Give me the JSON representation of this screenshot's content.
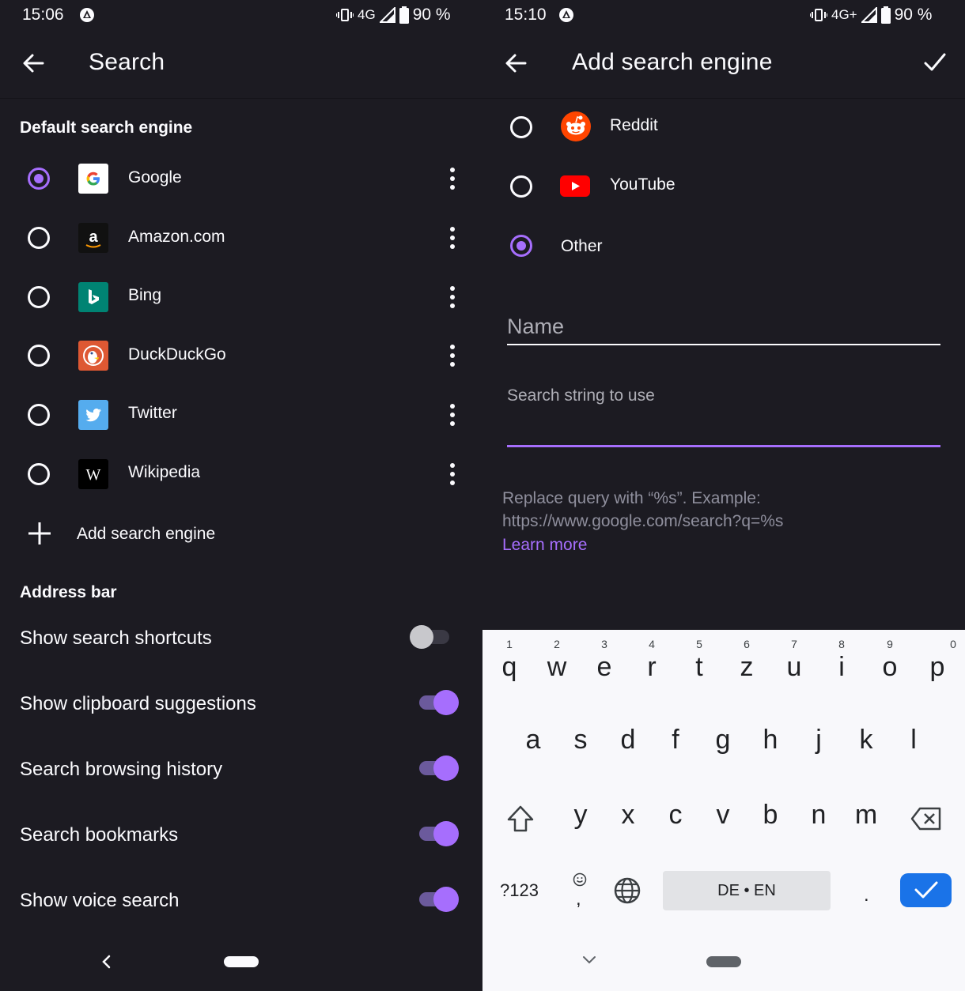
{
  "left": {
    "status": {
      "time": "15:06",
      "network": "4G",
      "battery": "90 %"
    },
    "toolbar": {
      "title": "Search"
    },
    "default_section": {
      "title": "Default search engine"
    },
    "engines": [
      {
        "label": "Google",
        "selected": true,
        "icon": "google-icon"
      },
      {
        "label": "Amazon.com",
        "selected": false,
        "icon": "amazon-icon"
      },
      {
        "label": "Bing",
        "selected": false,
        "icon": "bing-icon"
      },
      {
        "label": "DuckDuckGo",
        "selected": false,
        "icon": "duckduckgo-icon"
      },
      {
        "label": "Twitter",
        "selected": false,
        "icon": "twitter-icon"
      },
      {
        "label": "Wikipedia",
        "selected": false,
        "icon": "wikipedia-icon"
      }
    ],
    "add_engine": {
      "label": "Add search engine"
    },
    "address_section": {
      "title": "Address bar"
    },
    "settings": [
      {
        "label": "Show search shortcuts",
        "enabled": false
      },
      {
        "label": "Show clipboard suggestions",
        "enabled": true
      },
      {
        "label": "Search browsing history",
        "enabled": true
      },
      {
        "label": "Search bookmarks",
        "enabled": true
      },
      {
        "label": "Show voice search",
        "enabled": true
      }
    ]
  },
  "right": {
    "status": {
      "time": "15:10",
      "network": "4G+",
      "battery": "90 %"
    },
    "toolbar": {
      "title": "Add search engine"
    },
    "options": [
      {
        "label": "Reddit",
        "selected": false,
        "icon": "reddit-icon"
      },
      {
        "label": "YouTube",
        "selected": false,
        "icon": "youtube-icon"
      },
      {
        "label": "Other",
        "selected": true
      }
    ],
    "name_field": {
      "placeholder": "Name"
    },
    "search_string_field": {
      "placeholder": "Search string to use"
    },
    "help": {
      "line1": "Replace query with “%s”. Example:",
      "line2": "https://www.google.com/search?q=%s",
      "learn_more": "Learn more"
    },
    "keyboard": {
      "row1": [
        [
          "q",
          "1"
        ],
        [
          "w",
          "2"
        ],
        [
          "e",
          "3"
        ],
        [
          "r",
          "4"
        ],
        [
          "t",
          "5"
        ],
        [
          "z",
          "6"
        ],
        [
          "u",
          "7"
        ],
        [
          "i",
          "8"
        ],
        [
          "o",
          "9"
        ],
        [
          "p",
          "0"
        ]
      ],
      "row2": [
        "a",
        "s",
        "d",
        "f",
        "g",
        "h",
        "j",
        "k",
        "l"
      ],
      "row3": [
        "y",
        "x",
        "c",
        "v",
        "b",
        "n",
        "m"
      ],
      "symbols": "?123",
      "comma": ",",
      "space": "DE • EN",
      "period": "."
    }
  },
  "colors": {
    "accent": "#a66efd",
    "background": "#1c1b22",
    "keyboard_bg": "#f8f8fb",
    "enter": "#1a73e8"
  }
}
